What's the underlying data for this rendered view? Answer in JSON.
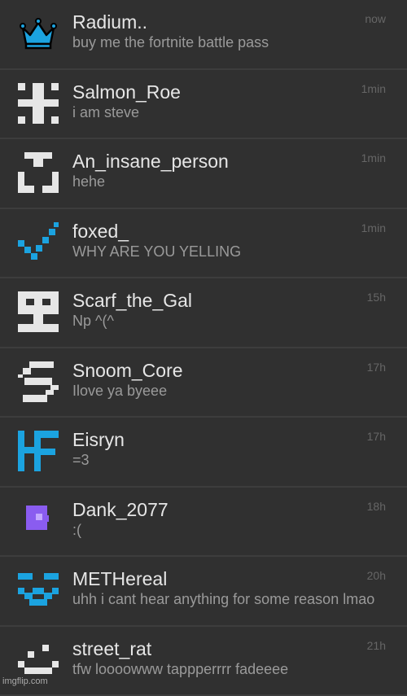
{
  "chats": [
    {
      "name": "Radium..",
      "message": "buy me the fortnite battle pass",
      "time": "now",
      "avatar_icon": "crown-icon",
      "avatar_color": "#1ba3e0"
    },
    {
      "name": "Salmon_Roe",
      "message": "i am steve",
      "time": "1min",
      "avatar_icon": "pixel-hash-icon",
      "avatar_color": "#e6e6e6"
    },
    {
      "name": "An_insane_person",
      "message": "hehe",
      "time": "1min",
      "avatar_icon": "pixel-face-icon",
      "avatar_color": "#e6e6e6"
    },
    {
      "name": "foxed_",
      "message": "WHY ARE YOU YELLING",
      "time": "1min",
      "avatar_icon": "checkmark-icon",
      "avatar_color": "#1ba3e0"
    },
    {
      "name": "Scarf_the_Gal",
      "message": "Np ^(^",
      "time": "15h",
      "avatar_icon": "pixel-robot-icon",
      "avatar_color": "#e6e6e6"
    },
    {
      "name": "Snoom_Core",
      "message": "Ilove ya byeee",
      "time": "17h",
      "avatar_icon": "pixel-s-icon",
      "avatar_color": "#e6e6e6"
    },
    {
      "name": "Eisryn",
      "message": "=3",
      "time": "17h",
      "avatar_icon": "hf-letters-icon",
      "avatar_color": "#1ba3e0"
    },
    {
      "name": "Dank_2077",
      "message": ":(",
      "time": "18h",
      "avatar_icon": "purple-square-icon",
      "avatar_color": "#8a5cf0"
    },
    {
      "name": "METHereal",
      "message": "uhh i cant hear anything for some reason lmao",
      "time": "20h",
      "avatar_icon": "pixel-smile-icon",
      "avatar_color": "#1ba3e0"
    },
    {
      "name": "street_rat",
      "message": "tfw loooowww tappperrrr fadeeee",
      "time": "21h",
      "avatar_icon": "pixel-grin-icon",
      "avatar_color": "#e6e6e6"
    }
  ],
  "watermark": "imgflip.com"
}
